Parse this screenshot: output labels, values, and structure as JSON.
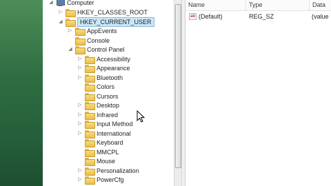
{
  "tree": {
    "computer": "Computer",
    "hkcr": "HKEY_CLASSES_ROOT",
    "hkcu": "HKEY_CURRENT_USER",
    "hkcu_children": [
      "AppEvents",
      "Console",
      "Control Panel"
    ],
    "control_panel_children": [
      "Accessibility",
      "Appearance",
      "Bluetooth",
      "Colors",
      "Cursors",
      "Desktop",
      "Infrared",
      "Input Method",
      "International",
      "Keyboard",
      "MMCPL",
      "Mouse",
      "Personalization",
      "PowerCfg"
    ]
  },
  "values_pane": {
    "columns": [
      "Name",
      "Type",
      "Data"
    ],
    "rows": [
      {
        "name": "(Default)",
        "type": "REG_SZ",
        "data": "(value"
      }
    ]
  }
}
